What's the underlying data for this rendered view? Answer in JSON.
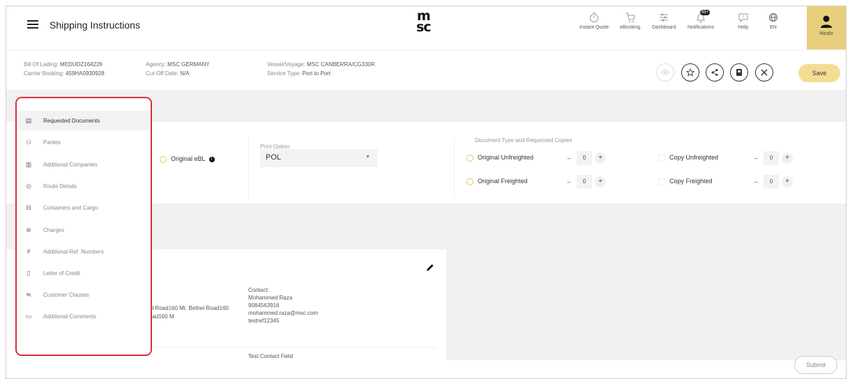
{
  "header": {
    "title": "Shipping Instructions",
    "logo_top": "m",
    "logo_bottom": "sc",
    "nav": [
      {
        "label": "Instant Quote",
        "icon": "stopwatch-icon"
      },
      {
        "label": "eBooking",
        "icon": "cart-icon"
      },
      {
        "label": "Dashboard",
        "icon": "sliders-icon"
      },
      {
        "label": "Notifications",
        "icon": "bell-icon",
        "badge": "99+"
      },
      {
        "label": "Help",
        "icon": "help-bubble-icon"
      },
      {
        "label": "EN",
        "icon": "globe-icon"
      }
    ],
    "user": "Nicolo"
  },
  "info": {
    "bill_of_lading_label": "Bill Of Lading:",
    "bill_of_lading": "MEDUDZ164226",
    "carrier_booking_label": "Carrier Booking:",
    "carrier_booking": "459HA0930928",
    "agency_label": "Agency:",
    "agency": "MSC GERMANY",
    "cutoff_label": "Cut-Off Date:",
    "cutoff": "N/A",
    "vessel_label": "Vessel/Voyage:",
    "vessel": "MSC CANBERRA/CG330R",
    "service_label": "Service Type:",
    "service": "Port to Port",
    "save_label": "Save"
  },
  "documents": {
    "original_ebl": "Original eBL",
    "print_option_label": "Print Option",
    "print_option_value": "POL",
    "doc_type_label": "Document Type and Requested Copies",
    "rows": [
      {
        "label": "Original Unfreighted",
        "value": "0"
      },
      {
        "label": "Original Freighted",
        "value": "0"
      },
      {
        "label": "Copy Unfreighted",
        "value": "0"
      },
      {
        "label": "Copy Freighted",
        "value": "0"
      }
    ],
    "minus": "–",
    "plus": "+"
  },
  "party": {
    "address_line1": "el Road160 Mt. Bethel Road160",
    "address_line2": "oad160 M",
    "contact_label": "Contact:",
    "contact_name": "Mohammed Raza",
    "contact_phone": "9084563916",
    "contact_email": "mohammed.raza@msc.com",
    "contact_ref": "testref12345",
    "test_contact": "Test Contact Field"
  },
  "sidebar": {
    "items": [
      {
        "label": "Requested Documents",
        "icon": "document-icon",
        "glyph": "▤",
        "active": true
      },
      {
        "label": "Parties",
        "icon": "people-icon",
        "glyph": "⚇",
        "active": false
      },
      {
        "label": "Additional Companies",
        "icon": "buildings-icon",
        "glyph": "▥",
        "active": false
      },
      {
        "label": "Route Details",
        "icon": "location-pin-icon",
        "glyph": "◎",
        "active": false
      },
      {
        "label": "Containers and Cargo",
        "icon": "container-icon",
        "glyph": "⊟",
        "active": false
      },
      {
        "label": "Charges",
        "icon": "coin-icon",
        "glyph": "⊚",
        "active": false
      },
      {
        "label": "Additional Ref. Numbers",
        "icon": "hash-icon",
        "glyph": "#",
        "active": false
      },
      {
        "label": "Letter of Credit",
        "icon": "page-icon",
        "glyph": "▯",
        "active": false
      },
      {
        "label": "Customer Clauses",
        "icon": "clauses-icon",
        "glyph": "≒",
        "active": false
      },
      {
        "label": "Additional Comments",
        "icon": "comment-icon",
        "glyph": "▭",
        "active": false
      }
    ]
  },
  "footer": {
    "submit_label": "Submit"
  }
}
